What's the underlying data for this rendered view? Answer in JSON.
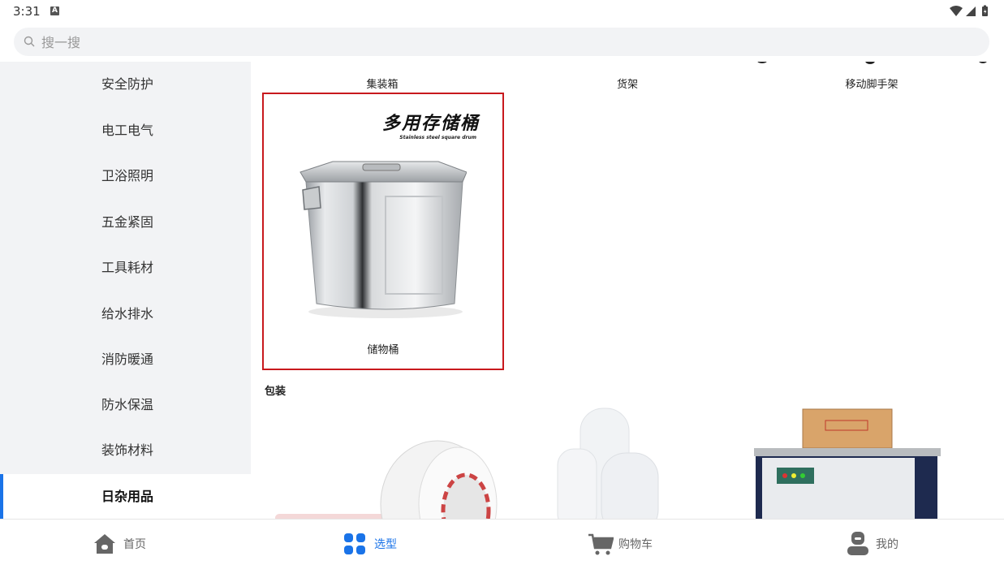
{
  "status_bar": {
    "time": "3:31",
    "notif_letter": "A"
  },
  "search": {
    "placeholder": "搜一搜"
  },
  "sidebar": {
    "items": [
      {
        "label": "安全防护"
      },
      {
        "label": "电工电气"
      },
      {
        "label": "卫浴照明"
      },
      {
        "label": "五金紧固"
      },
      {
        "label": "工具耗材"
      },
      {
        "label": "给水排水"
      },
      {
        "label": "消防暖通"
      },
      {
        "label": "防水保温"
      },
      {
        "label": "装饰材料"
      },
      {
        "label": "日杂用品",
        "active": true
      }
    ]
  },
  "content": {
    "top_items": [
      {
        "label": "集装箱"
      },
      {
        "label": "货架"
      },
      {
        "label": "移动脚手架"
      }
    ],
    "card": {
      "label": "储物桶",
      "banner_cn": "多用存储桶",
      "banner_en": "Stainless steel square drum"
    },
    "section": {
      "title": "包装"
    },
    "section_items": [
      {
        "name": "tape-roll"
      },
      {
        "name": "stretch-film"
      },
      {
        "name": "strapping-machine"
      }
    ]
  },
  "tabbar": {
    "tabs": [
      {
        "label": "首页",
        "icon": "home-icon"
      },
      {
        "label": "选型",
        "icon": "grid-icon",
        "active": true
      },
      {
        "label": "购物车",
        "icon": "cart-icon"
      },
      {
        "label": "我的",
        "icon": "user-icon"
      }
    ]
  },
  "colors": {
    "accent": "#1a73e8",
    "highlight_border": "#c8191d"
  }
}
